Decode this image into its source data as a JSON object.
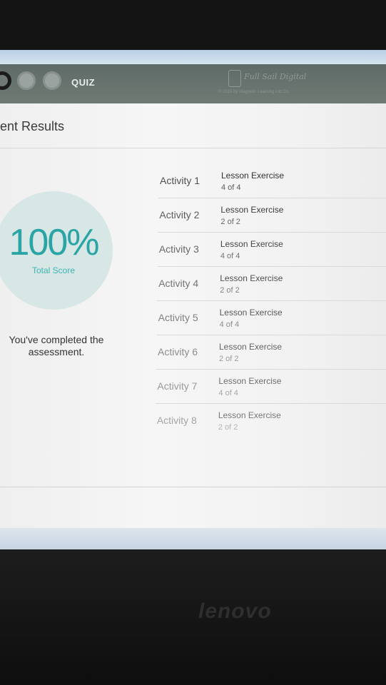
{
  "header": {
    "quiz_label": "QUIZ",
    "brand_name": "Full Sail Digital",
    "brand_sub": "© 2015 by Magnetic Learning Ltd Co."
  },
  "page": {
    "title": "ent Results"
  },
  "score": {
    "percent": "100%",
    "label": "Total Score",
    "completed_text": "You've completed the assessment."
  },
  "activities": [
    {
      "name": "Activity 1",
      "lesson": "Lesson Exercise",
      "count": "4 of 4"
    },
    {
      "name": "Activity 2",
      "lesson": "Lesson Exercise",
      "count": "2 of 2"
    },
    {
      "name": "Activity 3",
      "lesson": "Lesson Exercise",
      "count": "4 of 4"
    },
    {
      "name": "Activity 4",
      "lesson": "Lesson Exercise",
      "count": "2 of 2"
    },
    {
      "name": "Activity 5",
      "lesson": "Lesson Exercise",
      "count": "4 of 4"
    },
    {
      "name": "Activity 6",
      "lesson": "Lesson Exercise",
      "count": "2 of 2"
    },
    {
      "name": "Activity 7",
      "lesson": "Lesson Exercise",
      "count": "4 of 4"
    },
    {
      "name": "Activity 8",
      "lesson": "Lesson Exercise",
      "count": "2 of 2"
    }
  ],
  "hardware": {
    "laptop_brand": "lenovo"
  }
}
